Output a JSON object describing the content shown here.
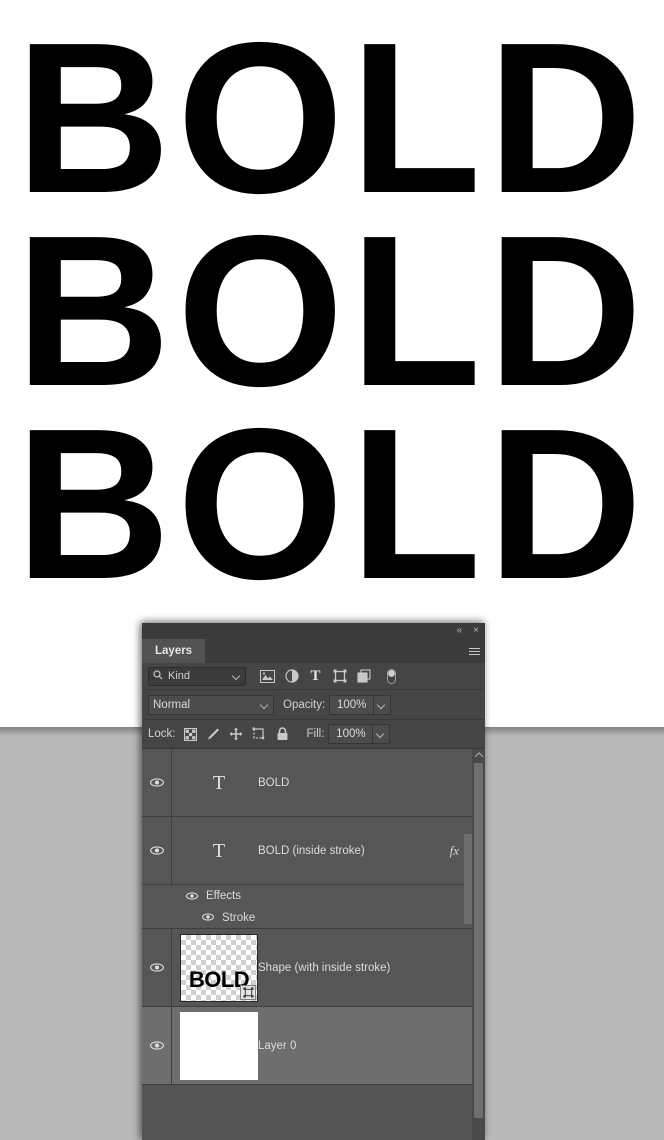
{
  "document": {
    "background_color": "#ffffff",
    "app_background_color": "#b9b9b9",
    "artwork_lines": [
      {
        "text": "BOLD",
        "style": "solid-fill"
      },
      {
        "text": "BOLD",
        "style": "inside-stroke-text"
      },
      {
        "text": "BOLD",
        "style": "shape-with-inside-stroke"
      }
    ]
  },
  "panel": {
    "title_tab": "Layers",
    "titlebar": {
      "collapse_label": "«",
      "close_label": "×"
    },
    "menu_icon": "hamburger-menu-icon",
    "filter": {
      "search_icon": "search-icon",
      "kind_label": "Kind",
      "chevron_icon": "chevron-down-icon",
      "type_filters": [
        {
          "name": "filter-pixel-layers",
          "icon": "image-icon"
        },
        {
          "name": "filter-adjustment-layers",
          "icon": "adjustment-half-circle-icon"
        },
        {
          "name": "filter-type-layers",
          "icon": "type-t-icon"
        },
        {
          "name": "filter-shape-layers",
          "icon": "shape-frame-icon"
        },
        {
          "name": "filter-smart-objects",
          "icon": "smart-object-icon"
        }
      ],
      "toggle_name": "filter-enable-toggle"
    },
    "blend": {
      "mode": "Normal",
      "opacity_label": "Opacity:",
      "opacity_value": "100%",
      "fill_label": "Fill:",
      "fill_value": "100%"
    },
    "lock": {
      "label": "Lock:",
      "icons": [
        {
          "name": "lock-transparent-pixels-icon",
          "icon": "checkerboard-icon"
        },
        {
          "name": "lock-image-pixels-icon",
          "icon": "brush-icon"
        },
        {
          "name": "lock-position-icon",
          "icon": "move-arrows-icon"
        },
        {
          "name": "lock-artboard-nesting-icon",
          "icon": "artboard-frame-icon"
        },
        {
          "name": "lock-all-icon",
          "icon": "padlock-icon"
        }
      ]
    },
    "layers": [
      {
        "name": "BOLD",
        "kind": "type",
        "visible": true,
        "selected": false,
        "thumb": "type-t-icon",
        "has_fx": false,
        "effects": []
      },
      {
        "name": "BOLD (inside stroke)",
        "kind": "type",
        "visible": true,
        "selected": false,
        "thumb": "type-t-icon",
        "has_fx": true,
        "fx_label": "fx",
        "effects_group_label": "Effects",
        "effects": [
          {
            "label": "Stroke",
            "visible": true
          }
        ]
      },
      {
        "name": "Shape (with inside stroke)",
        "kind": "shape",
        "visible": true,
        "selected": false,
        "thumb": "shape-thumbnail",
        "thumb_text": "BOLD",
        "has_fx": false,
        "effects": []
      },
      {
        "name": "Layer 0",
        "kind": "pixel",
        "visible": true,
        "selected": true,
        "thumb": "white-thumbnail",
        "has_fx": false,
        "effects": []
      }
    ]
  },
  "colors": {
    "panel_bg": "#454545",
    "panel_header_bg": "#3b3b3b",
    "tab_active_bg": "#535353",
    "row_bg": "#565656",
    "row_selected_bg": "#6e6e6e",
    "text": "#dcdcdc",
    "artwork": "#000000"
  }
}
